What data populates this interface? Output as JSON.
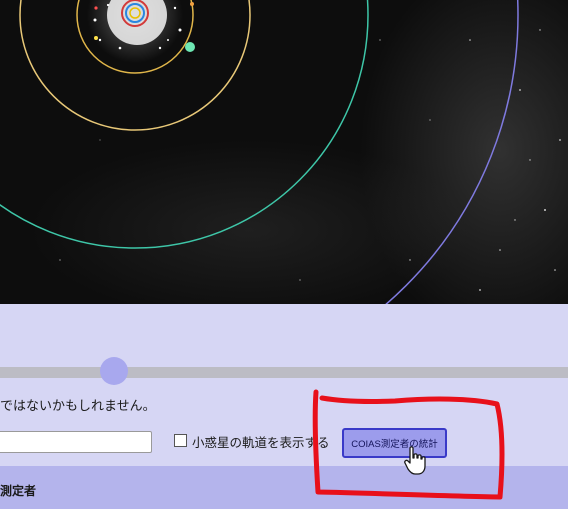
{
  "control_panel": {
    "notice_text": "ではないかもしれません。",
    "search_input": {
      "value": ""
    },
    "show_orbit_checkbox": {
      "label": "小惑星の軌道を表示する",
      "checked": false
    },
    "stats_button_label": "COIAS測定者の統計",
    "time_slider": {
      "position_fraction": 0.2
    }
  },
  "section_header": {
    "label": "測定者"
  },
  "colors": {
    "space_background": "#0d0d0d",
    "panel_background": "#d6d6f4",
    "header_background": "#b4b4ec",
    "button_background": "#9c9cec",
    "button_border": "#3a3ac8",
    "annotation_red": "#e8101a",
    "orbit_inner": "#e0b64a",
    "orbit_middle": "#e8c878",
    "orbit_teal": "#3ec6a8",
    "orbit_outer": "#7f7adf"
  },
  "icons": {
    "cursor": "hand-pointer-icon"
  }
}
